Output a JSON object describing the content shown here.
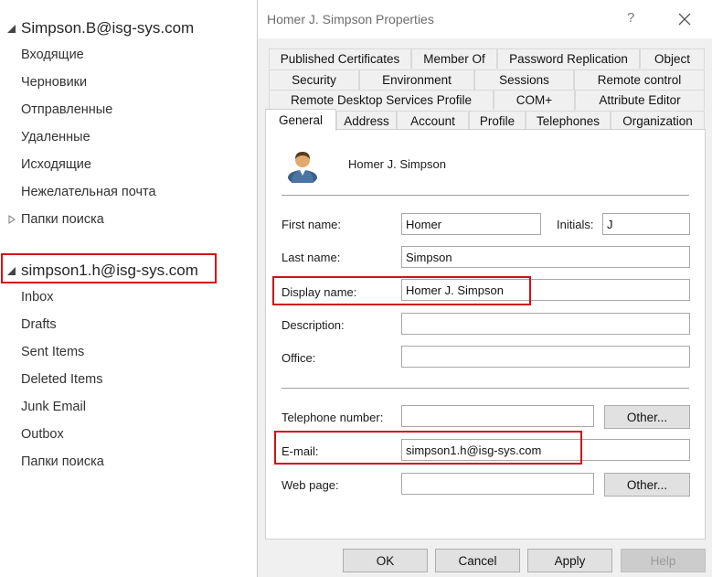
{
  "folders_pane": {
    "account1": {
      "name": "Simpson.B@isg-sys.com",
      "folders": [
        "Входящие",
        "Черновики",
        "Отправленные",
        "Удаленные",
        "Исходящие",
        "Нежелательная почта"
      ],
      "search_folders": "Папки поиска"
    },
    "account2": {
      "name": "simpson1.h@isg-sys.com",
      "folders": [
        "Inbox",
        "Drafts",
        "Sent Items",
        "Deleted Items",
        "Junk Email",
        "Outbox",
        "Папки поиска"
      ]
    }
  },
  "dialog": {
    "title": "Homer J. Simpson Properties",
    "help_glyph": "?",
    "tabs_row1": [
      "Published Certificates",
      "Member Of",
      "Password Replication",
      "Object"
    ],
    "tabs_row2": [
      "Security",
      "Environment",
      "Sessions",
      "Remote control"
    ],
    "tabs_row3": [
      "Remote Desktop Services Profile",
      "COM+",
      "Attribute Editor"
    ],
    "tabs_row4": [
      "General",
      "Address",
      "Account",
      "Profile",
      "Telephones",
      "Organization"
    ],
    "active_tab": "General",
    "general": {
      "display_header": "Homer J. Simpson",
      "first_name_label": "First name:",
      "first_name": "Homer",
      "initials_label": "Initials:",
      "initials": "J",
      "last_name_label": "Last name:",
      "last_name": "Simpson",
      "display_name_label": "Display name:",
      "display_name": "Homer J. Simpson",
      "description_label": "Description:",
      "description": "",
      "office_label": "Office:",
      "office": "",
      "telephone_label": "Telephone number:",
      "telephone": "",
      "other_label": "Other...",
      "email_label": "E-mail:",
      "email": "simpson1.h@isg-sys.com",
      "webpage_label": "Web page:",
      "webpage": ""
    },
    "buttons": {
      "ok": "OK",
      "cancel": "Cancel",
      "apply": "Apply",
      "help": "Help"
    }
  },
  "colors": {
    "highlight_box": "#d0121b",
    "dialog_bg": "#f0f0f0",
    "panel_bg": "#ffffff"
  }
}
